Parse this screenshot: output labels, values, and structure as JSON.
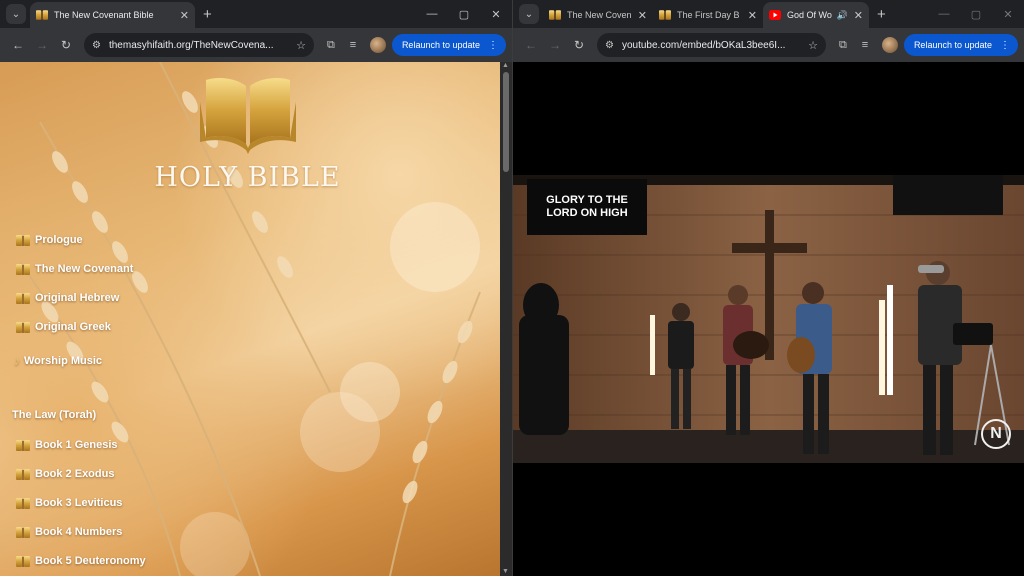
{
  "left_window": {
    "tabs": [
      {
        "title": "The New Covenant Bible",
        "active": true
      }
    ],
    "address": "themasyhifaith.org/TheNewCovena...",
    "relaunch_label": "Relaunch to update",
    "site": {
      "title": "HOLY BIBLE",
      "menu": [
        {
          "label": "Prologue"
        },
        {
          "label": "The New Covenant"
        },
        {
          "label": "Original Hebrew"
        },
        {
          "label": "Original Greek"
        },
        {
          "label": "Worship Music"
        }
      ],
      "section_heading": "The Law (Torah)",
      "books": [
        {
          "label": "Book 1 Genesis"
        },
        {
          "label": "Book 2 Exodus"
        },
        {
          "label": "Book 3 Leviticus"
        },
        {
          "label": "Book 4 Numbers"
        },
        {
          "label": "Book 5 Deuteronomy"
        }
      ]
    }
  },
  "right_window": {
    "tabs": [
      {
        "title": "The New Coven",
        "active": false
      },
      {
        "title": "The First Day B",
        "active": false
      },
      {
        "title": "God Of Wo",
        "active": true
      }
    ],
    "address": "youtube.com/embed/bOKaL3bee6I...",
    "relaunch_label": "Relaunch to update",
    "video": {
      "sign_line1": "GLORY TO THE",
      "sign_line2": "LORD ON HIGH",
      "channel_logo": "N"
    }
  },
  "colors": {
    "chrome_dark": "#202124",
    "toolbar": "#35363a",
    "relaunch_blue": "#0b57d0",
    "gold": "#c9962e"
  }
}
